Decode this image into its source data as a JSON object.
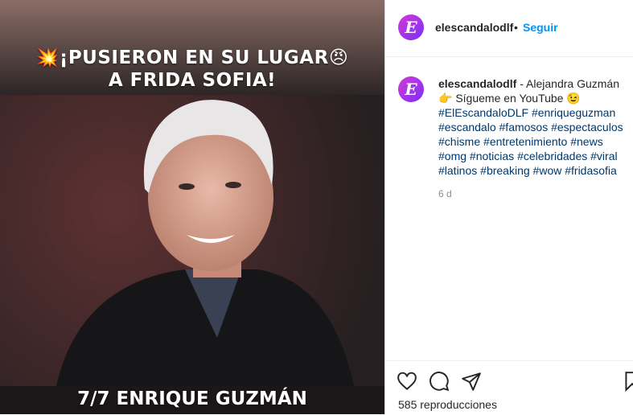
{
  "post": {
    "headline_line1": "💥¡PUSIERON EN SU LUGAR😠",
    "headline_line2": "A FRIDA SOFIA!",
    "caption": "7/7 ENRIQUE GUZMÁN"
  },
  "header": {
    "avatar_letter": "E",
    "username": "elescandalodlf",
    "separator": "•",
    "follow_label": "Seguir"
  },
  "comment": {
    "avatar_letter": "E",
    "username": "elescandalodlf",
    "text_line1": "- Alejandra Guzmán",
    "text_line2": "👉 Sígueme en YouTube 😉",
    "hashtags": [
      "#ElEscandaloDLF",
      "#enriqueguzman",
      "#escandalo",
      "#famosos",
      "#espectaculos",
      "#chisme",
      "#entretenimiento",
      "#news",
      "#omg",
      "#noticias",
      "#celebridades",
      "#viral",
      "#latinos",
      "#breaking",
      "#wow",
      "#fridasofia"
    ],
    "time": "6 d"
  },
  "actions": {
    "like_icon": "heart-icon",
    "comment_icon": "comment-icon",
    "share_icon": "send-icon",
    "save_icon": "bookmark-icon",
    "views": "585 reproducciones"
  },
  "colors": {
    "accent": "#0095f6",
    "hashtag": "#00376b",
    "avatar_gradient_start": "#d33ad6",
    "avatar_gradient_end": "#7b2ff7"
  }
}
